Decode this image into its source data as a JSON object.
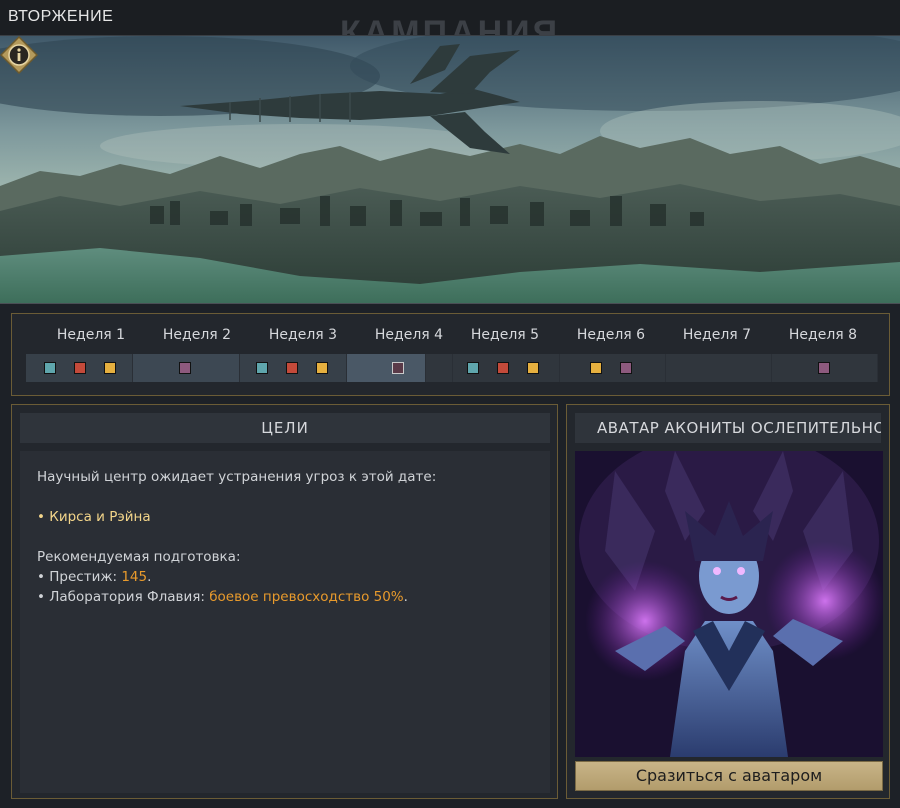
{
  "header": {
    "title": "ВТОРЖЕНИЕ",
    "background_title": "КАМПАНИЯ"
  },
  "hero": {
    "info_icon": "info-icon"
  },
  "weeks": [
    {
      "label": "Неделя 1",
      "markers": [
        "teal",
        "red",
        "yellow"
      ]
    },
    {
      "label": "Неделя 2",
      "markers": [
        "purple"
      ]
    },
    {
      "label": "Неделя 3",
      "markers": [
        "teal",
        "red",
        "yellow"
      ]
    },
    {
      "label": "Неделя 4",
      "markers": [
        "dark"
      ]
    },
    {
      "label": "Неделя 5",
      "markers": [
        "teal",
        "red",
        "yellow"
      ]
    },
    {
      "label": "Неделя 6",
      "markers": [
        "yellow",
        "purple"
      ]
    },
    {
      "label": "Неделя 7",
      "markers": []
    },
    {
      "label": "Неделя 8",
      "markers": [
        "purple"
      ]
    }
  ],
  "colors": {
    "teal": "#5fa6ad",
    "red": "#c44a3a",
    "yellow": "#e6b03f",
    "purple": "#8d5a7e",
    "accent_gold": "#f3d58a",
    "accent_orange": "#e89a2c"
  },
  "goals": {
    "header": "ЦЕЛИ",
    "intro": "Научный центр ожидает устранения угроз к этой дате:",
    "threat": "• Кирса и Рэйна",
    "prep_title": "Рекомендуемая подготовка:",
    "prestige_label": "• Престиж: ",
    "prestige_value": "145",
    "lab_label": "• Лаборатория Флавия: ",
    "lab_value": "боевое превосходство 50%",
    "period": "."
  },
  "avatar": {
    "header": "АВАТАР АКОНИТЫ ОСЛЕПИТЕЛЬНОЙ",
    "fight_button": "Сразиться с аватаром"
  }
}
